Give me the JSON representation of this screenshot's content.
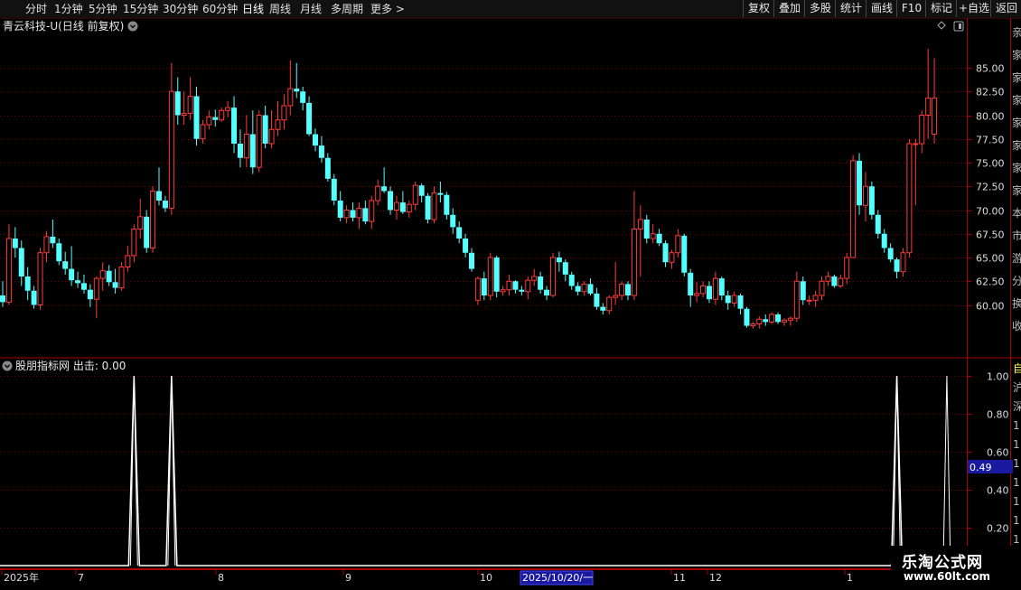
{
  "toolbar": {
    "periods": [
      "分时",
      "1分钟",
      "5分钟",
      "15分钟",
      "30分钟",
      "60分钟",
      "日线",
      "周线",
      "月线",
      "多周期",
      "更多 >"
    ],
    "active_period": "日线",
    "actions": [
      "复权",
      "叠加",
      "多股",
      "统计",
      "画线",
      "F10",
      "标记",
      "+自选",
      "返回"
    ]
  },
  "main_pane": {
    "title": "青云科技-U(日线 前复权)",
    "y_ticks": [
      "85.00",
      "82.50",
      "80.00",
      "77.50",
      "75.00",
      "72.50",
      "70.00",
      "67.50",
      "65.00",
      "62.50",
      "60.00"
    ],
    "right_edge_glyphs": [
      "亲",
      "家",
      "家",
      "家",
      "家",
      "家",
      "家",
      "家",
      "本",
      "市",
      "游",
      "分",
      "换",
      "收"
    ]
  },
  "indicator_pane": {
    "title": "股朋指标网 出击: 0.00",
    "y_ticks": [
      "1.00",
      "0.80",
      "0.60",
      "0.40",
      "0.20"
    ],
    "current_value": "0.49",
    "right_edge_glyphs": [
      "自",
      "沪",
      "深",
      "1",
      "1",
      "1",
      "1",
      "1",
      "1",
      "1"
    ]
  },
  "x_axis": {
    "labels": [
      "2025年",
      "7",
      "8",
      "9",
      "10",
      "2025/10/20/一",
      "11",
      "12",
      "1"
    ]
  },
  "colors": {
    "up": "#ff3b3b",
    "down": "#54ffff",
    "grid": "#7a0000",
    "line": "#ffffff",
    "cursor_box": "#1a1aa0"
  },
  "watermark": {
    "line1": "乐淘公式网",
    "line2": "www.60lt.com"
  },
  "chart_data": [
    {
      "type": "candlestick",
      "title": "青云科技-U(日线 前复权)",
      "ylim": [
        57.5,
        87.5
      ],
      "candles": [
        [
          61.0,
          62.5,
          59.8,
          60.3
        ],
        [
          60.3,
          68.5,
          60.0,
          67.0
        ],
        [
          67.0,
          68.2,
          65.0,
          66.0
        ],
        [
          66.0,
          66.8,
          62.0,
          63.0
        ],
        [
          63.0,
          64.0,
          60.5,
          61.5
        ],
        [
          61.5,
          62.0,
          59.6,
          60.0
        ],
        [
          60.0,
          66.0,
          59.5,
          65.5
        ],
        [
          65.5,
          67.8,
          64.5,
          67.2
        ],
        [
          67.2,
          69.0,
          66.0,
          66.5
        ],
        [
          66.5,
          67.0,
          64.2,
          64.6
        ],
        [
          64.6,
          65.6,
          63.2,
          63.8
        ],
        [
          63.8,
          66.2,
          62.0,
          62.6
        ],
        [
          62.6,
          63.5,
          61.8,
          62.3
        ],
        [
          62.3,
          63.2,
          61.2,
          61.6
        ],
        [
          61.6,
          62.2,
          59.8,
          60.6
        ],
        [
          60.6,
          63.0,
          58.6,
          62.8
        ],
        [
          62.8,
          64.5,
          61.5,
          63.6
        ],
        [
          63.6,
          64.2,
          62.0,
          62.4
        ],
        [
          62.4,
          63.8,
          61.2,
          61.8
        ],
        [
          61.8,
          64.5,
          61.5,
          64.0
        ],
        [
          64.0,
          66.2,
          63.5,
          65.2
        ],
        [
          65.2,
          68.5,
          64.5,
          68.0
        ],
        [
          68.0,
          71.2,
          67.0,
          69.3
        ],
        [
          69.3,
          70.0,
          65.5,
          66.0
        ],
        [
          66.0,
          72.5,
          65.5,
          72.0
        ],
        [
          72.0,
          74.5,
          70.5,
          71.0
        ],
        [
          71.0,
          71.5,
          69.8,
          70.2
        ],
        [
          70.2,
          85.5,
          69.5,
          82.5
        ],
        [
          82.5,
          84.0,
          79.0,
          80.0
        ],
        [
          80.0,
          82.5,
          79.0,
          80.2
        ],
        [
          80.2,
          84.0,
          79.5,
          82.0
        ],
        [
          82.0,
          83.0,
          76.8,
          77.5
        ],
        [
          77.5,
          79.5,
          77.0,
          79.0
        ],
        [
          79.0,
          80.5,
          78.5,
          79.8
        ],
        [
          79.8,
          80.6,
          78.8,
          79.5
        ],
        [
          79.5,
          80.8,
          79.3,
          80.5
        ],
        [
          80.5,
          81.5,
          79.8,
          80.8
        ],
        [
          80.8,
          82.0,
          76.0,
          77.0
        ],
        [
          77.0,
          78.5,
          74.5,
          75.5
        ],
        [
          75.5,
          80.0,
          74.5,
          78.0
        ],
        [
          78.0,
          80.5,
          73.8,
          74.5
        ],
        [
          74.5,
          80.5,
          74.0,
          80.0
        ],
        [
          80.0,
          81.0,
          76.5,
          77.0
        ],
        [
          77.0,
          80.5,
          76.5,
          78.5
        ],
        [
          78.5,
          81.5,
          77.8,
          79.5
        ],
        [
          79.5,
          82.2,
          78.5,
          81.0
        ],
        [
          81.0,
          85.8,
          80.0,
          82.8
        ],
        [
          82.8,
          85.5,
          81.8,
          82.5
        ],
        [
          82.5,
          83.0,
          80.5,
          81.3
        ],
        [
          81.3,
          82.0,
          77.8,
          78.0
        ],
        [
          78.0,
          78.6,
          76.2,
          76.8
        ],
        [
          76.8,
          77.8,
          75.0,
          75.5
        ],
        [
          75.5,
          76.0,
          73.0,
          73.3
        ],
        [
          73.3,
          73.8,
          70.5,
          71.0
        ],
        [
          71.0,
          72.0,
          68.8,
          69.2
        ],
        [
          69.2,
          70.5,
          68.6,
          70.0
        ],
        [
          70.0,
          70.8,
          68.8,
          69.2
        ],
        [
          69.2,
          70.8,
          68.0,
          70.2
        ],
        [
          70.2,
          71.0,
          68.5,
          68.8
        ],
        [
          68.8,
          71.5,
          68.0,
          71.0
        ],
        [
          71.0,
          73.2,
          70.5,
          72.5
        ],
        [
          72.5,
          74.5,
          71.8,
          72.0
        ],
        [
          72.0,
          72.5,
          69.5,
          70.0
        ],
        [
          70.0,
          71.5,
          69.0,
          70.8
        ],
        [
          70.8,
          72.0,
          69.6,
          69.8
        ],
        [
          69.8,
          71.0,
          69.2,
          70.6
        ],
        [
          70.6,
          73.0,
          70.0,
          72.6
        ],
        [
          72.6,
          72.8,
          70.8,
          71.5
        ],
        [
          71.5,
          71.8,
          68.6,
          69.0
        ],
        [
          69.0,
          72.5,
          68.6,
          71.8
        ],
        [
          71.8,
          73.0,
          70.8,
          71.6
        ],
        [
          71.6,
          71.9,
          69.0,
          69.5
        ],
        [
          69.5,
          70.2,
          67.5,
          68.2
        ],
        [
          68.2,
          68.8,
          66.5,
          67.0
        ],
        [
          67.0,
          67.5,
          65.0,
          65.5
        ],
        [
          65.5,
          66.0,
          63.5,
          63.8
        ],
        [
          60.5,
          63.0,
          60.0,
          62.8
        ],
        [
          62.8,
          63.5,
          60.5,
          61.0
        ],
        [
          61.0,
          65.5,
          60.5,
          65.0
        ],
        [
          65.0,
          65.2,
          60.8,
          61.4
        ],
        [
          61.4,
          62.0,
          61.0,
          61.6
        ],
        [
          61.6,
          63.2,
          61.0,
          62.5
        ],
        [
          62.5,
          62.6,
          61.2,
          61.6
        ],
        [
          61.6,
          62.0,
          61.0,
          61.4
        ],
        [
          61.4,
          63.0,
          60.6,
          62.6
        ],
        [
          62.6,
          63.8,
          62.0,
          63.0
        ],
        [
          63.0,
          63.5,
          61.2,
          61.6
        ],
        [
          61.6,
          62.0,
          60.5,
          61.0
        ],
        [
          61.0,
          65.5,
          60.8,
          65.0
        ],
        [
          65.0,
          65.6,
          63.5,
          64.5
        ],
        [
          64.5,
          64.8,
          62.5,
          63.2
        ],
        [
          63.2,
          63.5,
          61.6,
          62.0
        ],
        [
          62.0,
          62.4,
          61.0,
          61.4
        ],
        [
          61.4,
          62.5,
          61.0,
          62.2
        ],
        [
          62.2,
          62.8,
          61.0,
          61.2
        ],
        [
          61.2,
          61.8,
          59.5,
          59.8
        ],
        [
          59.8,
          60.2,
          59.0,
          59.4
        ],
        [
          59.4,
          61.0,
          59.0,
          60.8
        ],
        [
          60.8,
          64.5,
          60.0,
          61.0
        ],
        [
          61.0,
          62.5,
          60.5,
          62.2
        ],
        [
          62.2,
          62.5,
          60.5,
          61.0
        ],
        [
          61.0,
          72.0,
          60.5,
          68.0
        ],
        [
          68.0,
          70.5,
          63.0,
          69.0
        ],
        [
          69.0,
          69.5,
          66.5,
          67.0
        ],
        [
          67.0,
          68.5,
          66.5,
          67.5
        ],
        [
          67.5,
          68.0,
          66.2,
          66.5
        ],
        [
          66.5,
          66.8,
          64.0,
          64.5
        ],
        [
          64.5,
          65.8,
          63.8,
          65.5
        ],
        [
          65.5,
          68.0,
          65.0,
          67.3
        ],
        [
          67.3,
          67.5,
          63.0,
          63.4
        ],
        [
          63.4,
          63.8,
          59.8,
          61.0
        ],
        [
          61.0,
          62.4,
          60.3,
          61.2
        ],
        [
          61.2,
          62.5,
          60.8,
          62.0
        ],
        [
          62.0,
          62.5,
          60.2,
          60.6
        ],
        [
          60.6,
          63.5,
          60.0,
          62.8
        ],
        [
          62.8,
          63.0,
          60.5,
          61.0
        ],
        [
          61.0,
          61.5,
          59.5,
          60.2
        ],
        [
          60.2,
          61.4,
          59.8,
          61.0
        ],
        [
          61.0,
          61.2,
          59.0,
          59.6
        ],
        [
          59.6,
          59.8,
          57.6,
          57.8
        ],
        [
          57.8,
          58.2,
          57.5,
          58.0
        ],
        [
          58.0,
          58.8,
          57.5,
          58.5
        ],
        [
          58.5,
          59.0,
          57.8,
          58.2
        ],
        [
          58.2,
          59.2,
          58.0,
          59.0
        ],
        [
          59.0,
          59.2,
          58.0,
          58.2
        ],
        [
          58.2,
          58.6,
          57.8,
          58.4
        ],
        [
          58.4,
          58.8,
          57.8,
          58.6
        ],
        [
          58.6,
          63.5,
          58.2,
          62.5
        ],
        [
          62.5,
          63.0,
          60.0,
          60.5
        ],
        [
          60.5,
          61.0,
          60.0,
          60.5
        ],
        [
          60.5,
          61.5,
          59.8,
          61.0
        ],
        [
          61.0,
          63.0,
          60.5,
          62.5
        ],
        [
          62.5,
          63.5,
          62.0,
          63.0
        ],
        [
          63.0,
          63.2,
          61.8,
          62.0
        ],
        [
          62.0,
          63.2,
          61.8,
          62.8
        ],
        [
          62.8,
          65.5,
          62.2,
          65.0
        ],
        [
          65.0,
          75.8,
          65.0,
          75.2
        ],
        [
          75.2,
          76.0,
          69.5,
          70.5
        ],
        [
          70.5,
          74.0,
          68.8,
          72.5
        ],
        [
          72.5,
          73.0,
          69.0,
          69.5
        ],
        [
          69.5,
          70.0,
          67.0,
          67.5
        ],
        [
          67.5,
          68.0,
          65.5,
          66.0
        ],
        [
          66.0,
          66.5,
          64.5,
          64.8
        ],
        [
          64.8,
          65.0,
          62.8,
          63.5
        ],
        [
          63.5,
          66.0,
          63.0,
          65.5
        ],
        [
          65.5,
          77.5,
          65.0,
          77.0
        ],
        [
          77.0,
          77.5,
          70.5,
          77.0
        ],
        [
          77.0,
          80.5,
          76.0,
          80.0
        ],
        [
          80.0,
          87.0,
          77.5,
          81.8
        ],
        [
          78.0,
          86.0,
          77.0,
          81.8
        ]
      ]
    },
    {
      "type": "line",
      "title": "股朋指标网 出击: 0.00",
      "ylim": [
        0,
        1.05
      ],
      "peaks": [
        {
          "index": 21,
          "value": 1.0
        },
        {
          "index": 27,
          "value": 1.0
        },
        {
          "index": 143,
          "value": 1.0
        },
        {
          "index": 151,
          "value": 1.0
        }
      ],
      "baseline": 0
    }
  ]
}
